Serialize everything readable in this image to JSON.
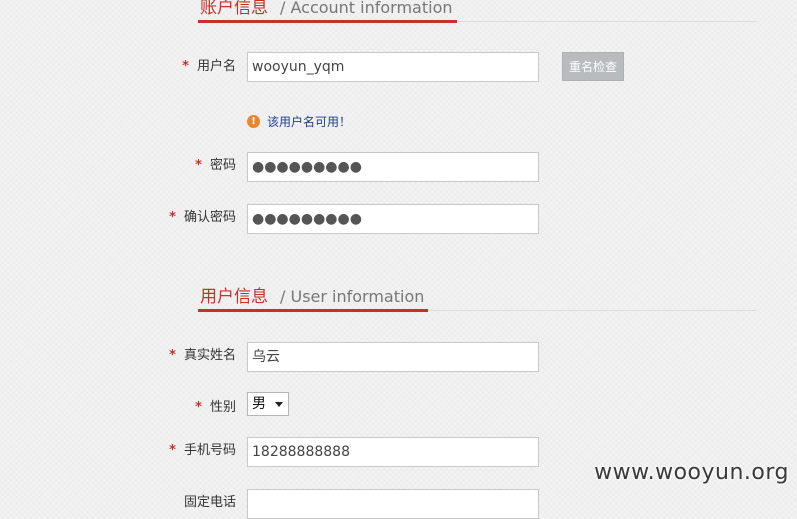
{
  "sections": {
    "account": {
      "title_cn": "账户信息",
      "title_en": "/ Account information"
    },
    "user": {
      "title_cn": "用户信息",
      "title_en": "/ User information"
    }
  },
  "required_marker": "*",
  "account_form": {
    "username": {
      "label": "用户名",
      "value": "wooyun_yqm"
    },
    "check_button": "重名检查",
    "availability_hint": "该用户名可用！",
    "password": {
      "label": "密码",
      "value": "●●●●●●●●●"
    },
    "confirm_password": {
      "label": "确认密码",
      "value": "●●●●●●●●●"
    }
  },
  "user_form": {
    "real_name": {
      "label": "真实姓名",
      "value": "乌云"
    },
    "gender": {
      "label": "性别",
      "selected": "男"
    },
    "mobile": {
      "label": "手机号码",
      "value": "18288888888"
    },
    "landline": {
      "label": "固定电话",
      "value": ""
    }
  },
  "watermark": "www.wooyun.org",
  "colors": {
    "accent": "#c9302c",
    "hint_text": "#1f3d8a",
    "hint_icon": "#e8872e",
    "button_bg": "#b9bcbf"
  }
}
